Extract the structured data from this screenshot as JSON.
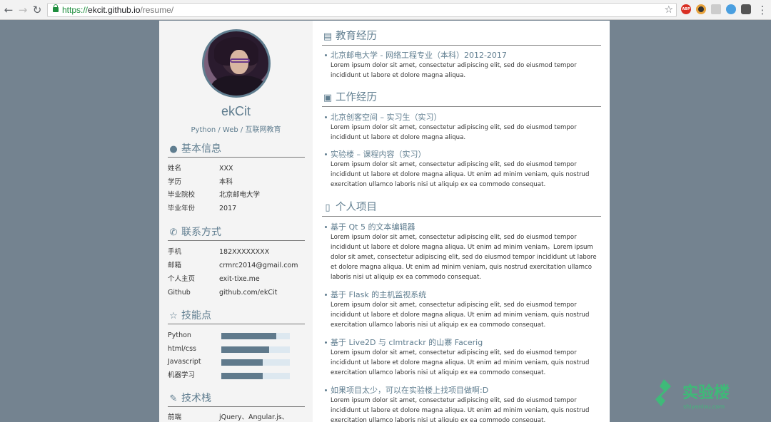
{
  "browser": {
    "url_scheme": "https://",
    "url_host": "ekcit.github.io",
    "url_path": "/resume/",
    "ext_abp": "ABP"
  },
  "profile": {
    "name": "ekCit",
    "subtitle": "Python / Web / 互联网教育"
  },
  "basic_info": {
    "title": "基本信息",
    "rows": [
      {
        "k": "姓名",
        "v": "XXX"
      },
      {
        "k": "学历",
        "v": "本科"
      },
      {
        "k": "毕业院校",
        "v": "北京邮电大学"
      },
      {
        "k": "毕业年份",
        "v": "2017"
      }
    ]
  },
  "contact": {
    "title": "联系方式",
    "rows": [
      {
        "k": "手机",
        "v": "182XXXXXXXX"
      },
      {
        "k": "邮箱",
        "v": "crmrc2014@gmail.com"
      },
      {
        "k": "个人主页",
        "v": "exit-tixe.me"
      },
      {
        "k": "Github",
        "v": "github.com/ekCit"
      }
    ]
  },
  "skills": {
    "title": "技能点",
    "rows": [
      {
        "k": "Python",
        "level": 0.8
      },
      {
        "k": "html/css",
        "level": 0.7
      },
      {
        "k": "Javascript",
        "level": 0.6
      },
      {
        "k": "机器学习",
        "level": 0.6
      }
    ]
  },
  "stack": {
    "title": "技术栈",
    "rows": [
      {
        "k": "前端",
        "v": "jQuery、Angular.js、"
      }
    ]
  },
  "education": {
    "title": "教育经历",
    "items": [
      {
        "title": "北京邮电大学 - 网络工程专业（本科）2012-2017",
        "desc": "Lorem ipsum dolor sit amet, consectetur adipiscing elit, sed do eiusmod tempor incididunt ut labore et dolore magna aliqua."
      }
    ]
  },
  "work": {
    "title": "工作经历",
    "items": [
      {
        "title": "北京创客空间 – 实习生（实习）",
        "desc": "Lorem ipsum dolor sit amet, consectetur adipiscing elit, sed do eiusmod tempor incididunt ut labore et dolore magna aliqua."
      },
      {
        "title": "实验楼 – 课程内容（实习）",
        "desc": "Lorem ipsum dolor sit amet, consectetur adipiscing elit, sed do eiusmod tempor incididunt ut labore et dolore magna aliqua. Ut enim ad minim veniam, quis nostrud exercitation ullamco laboris nisi ut aliquip ex ea commodo consequat."
      }
    ]
  },
  "projects": {
    "title": "个人项目",
    "items": [
      {
        "title": "基于 Qt 5 的文本编辑器",
        "desc": "Lorem ipsum dolor sit amet, consectetur adipiscing elit, sed do eiusmod tempor incididunt ut labore et dolore magna aliqua. Ut enim ad minim veniam。Lorem ipsum dolor sit amet, consectetur adipiscing elit, sed do eiusmod tempor incididunt ut labore et dolore magna aliqua. Ut enim ad minim veniam, quis nostrud exercitation ullamco laboris nisi ut aliquip ex ea commodo consequat."
      },
      {
        "title": "基于 Flask 的主机监视系统",
        "desc": "Lorem ipsum dolor sit amet, consectetur adipiscing elit, sed do eiusmod tempor incididunt ut labore et dolore magna aliqua. Ut enim ad minim veniam, quis nostrud exercitation ullamco laboris nisi ut aliquip ex ea commodo consequat."
      },
      {
        "title": "基于 Live2D 与 clmtrackr 的山寨 Facerig",
        "desc": "Lorem ipsum dolor sit amet, consectetur adipiscing elit, sed do eiusmod tempor incididunt ut labore et dolore magna aliqua. Ut enim ad minim veniam, quis nostrud exercitation ullamco laboris nisi ut aliquip ex ea commodo consequat."
      },
      {
        "title": "如果项目太少，可以在实验楼上找项目做啊:D",
        "desc": "Lorem ipsum dolor sit amet, consectetur adipiscing elit, sed do eiusmod tempor incididunt ut labore et dolore magna aliqua. Ut enim ad minim veniam, quis nostrud exercitation ullamco laboris nisi ut aliquip ex ea commodo consequat."
      }
    ]
  },
  "watermark": {
    "text": "实验楼",
    "sub": "shiyanlou.com"
  },
  "colors": {
    "accent": "#5f7d8f",
    "page_bg": "#748390",
    "left_bg": "#f4f4f4"
  }
}
